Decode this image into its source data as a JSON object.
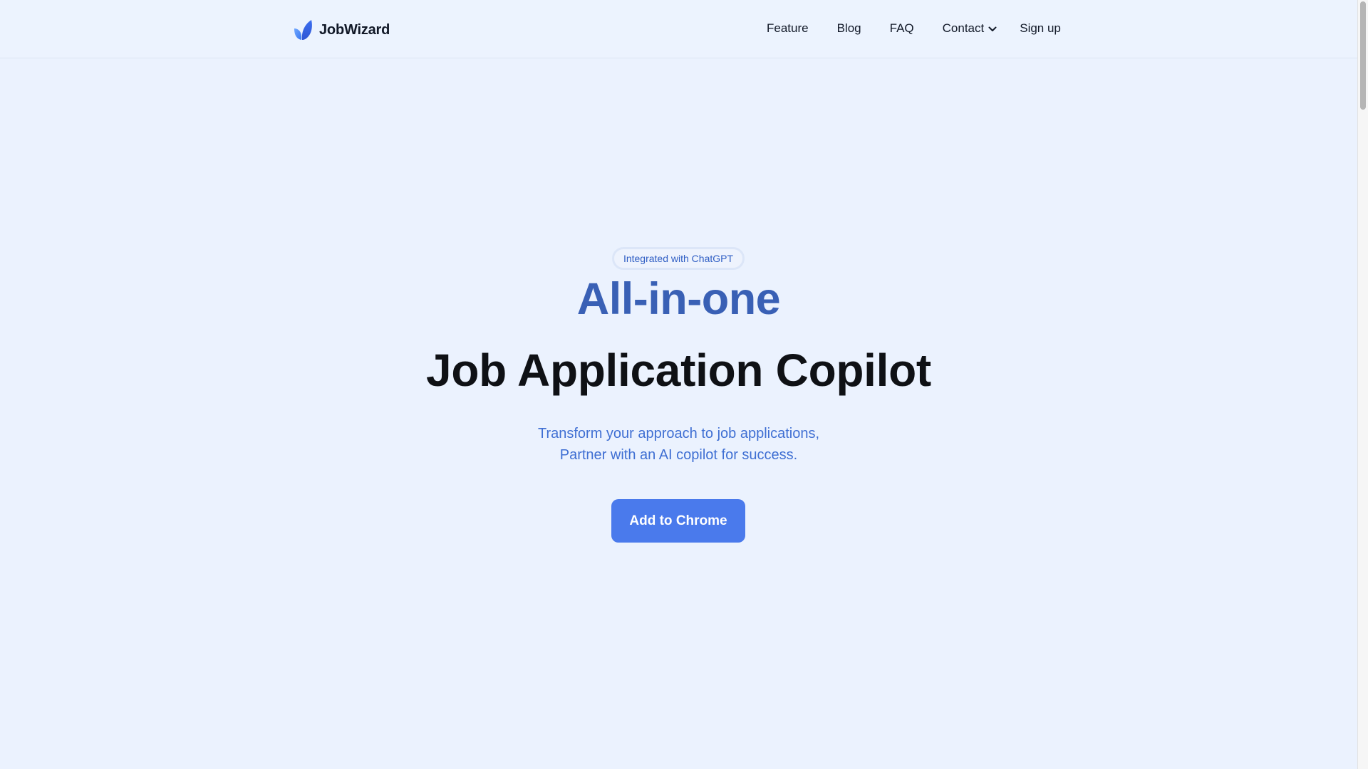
{
  "header": {
    "brand": "JobWizard",
    "nav": {
      "feature": "Feature",
      "blog": "Blog",
      "faq": "FAQ",
      "contact": "Contact",
      "signup": "Sign up"
    }
  },
  "hero": {
    "badge": "Integrated with ChatGPT",
    "headline_accent": "All-in-one",
    "headline_main": "Job Application Copilot",
    "subtitle_line1": "Transform your approach to job applications,",
    "subtitle_line2": "Partner with an AI copilot for success.",
    "cta_label": "Add to Chrome"
  },
  "icons": {
    "logo": "leaf-logo-icon",
    "contact_dropdown": "chevron-down-icon"
  },
  "colors": {
    "background": "#ebf2fe",
    "accent": "#3960b5",
    "cta": "#4a7aec",
    "subtitle": "#3f6fd3"
  }
}
